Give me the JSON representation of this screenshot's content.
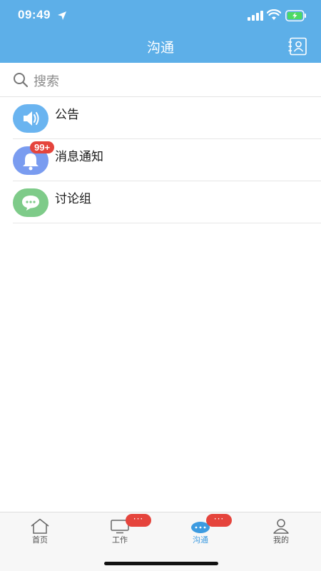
{
  "status_bar": {
    "time": "09:49"
  },
  "nav": {
    "title": "沟通"
  },
  "search": {
    "placeholder": "搜索"
  },
  "list": [
    {
      "label": "公告",
      "icon": "speaker-icon",
      "color": "#6ab4f0",
      "badge": ""
    },
    {
      "label": "消息通知",
      "icon": "bell-icon",
      "color": "#7a9cf0",
      "badge": "99+"
    },
    {
      "label": "讨论组",
      "icon": "chat-bubble-icon",
      "color": "#7ecb89",
      "badge": ""
    }
  ],
  "tabs": [
    {
      "label": "首页",
      "icon": "home-icon",
      "active": false,
      "badge": ""
    },
    {
      "label": "工作",
      "icon": "desktop-icon",
      "active": false,
      "badge": "···"
    },
    {
      "label": "沟通",
      "icon": "chat-icon",
      "active": true,
      "badge": "···"
    },
    {
      "label": "我的",
      "icon": "user-icon",
      "active": false,
      "badge": ""
    }
  ],
  "colors": {
    "primary": "#5dafe8",
    "badge": "#e5443c",
    "active_tab": "#3d9be0"
  }
}
